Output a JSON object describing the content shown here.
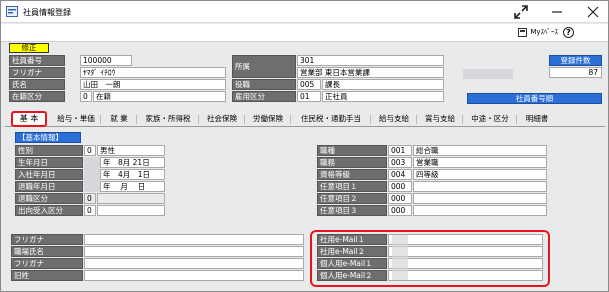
{
  "window": {
    "title": "社員情報登録"
  },
  "toolbar": {
    "myspace_label": "Myｽﾍﾟｰｽ",
    "help_label": "?"
  },
  "header": {
    "modify_badge": "修正",
    "left_fields": [
      {
        "label": "社員番号",
        "value": "100000"
      },
      {
        "label": "フリガナ",
        "value": "ﾔﾏﾀﾞ  ｲﾁﾛｳ"
      },
      {
        "label": "氏名",
        "value": "山田　一朗"
      },
      {
        "label": "在籍区分",
        "code": "0",
        "value": "在籍"
      }
    ],
    "mid_fields": [
      {
        "label": "所属",
        "code": "301",
        "value": "営業部 東日本営業課"
      },
      {
        "label": "役職",
        "code": "005",
        "value": "課長"
      },
      {
        "label": "雇用区分",
        "code": "01",
        "value": "正社員"
      }
    ],
    "register_count_label": "登録件数",
    "register_count_value": "87",
    "sort_order_label": "社員番号順"
  },
  "tabs": [
    {
      "label": "基 本",
      "active": true
    },
    {
      "label": "給与・単価"
    },
    {
      "label": "就 業"
    },
    {
      "label": "家族・所得税"
    },
    {
      "label": "社会保険"
    },
    {
      "label": "労働保険"
    },
    {
      "label": "住民税・通勤手当"
    },
    {
      "label": "給与支給"
    },
    {
      "label": "賞与支給"
    },
    {
      "label": "中途・区分"
    },
    {
      "label": "明細書"
    }
  ],
  "basic": {
    "section_title": "【基本情報】",
    "left_fields": [
      {
        "label": "性別",
        "code": "0",
        "value": "男性"
      },
      {
        "label": "生年月日",
        "value": "年　8月 21日"
      },
      {
        "label": "入社年月日",
        "value": "年　4月　1日"
      },
      {
        "label": "退職年月日",
        "value": "年　 月　 日"
      },
      {
        "label": "退職区分",
        "code": "0",
        "value": ""
      },
      {
        "label": "出向受入区分",
        "code": "0",
        "value": ""
      }
    ],
    "right_fields": [
      {
        "label": "職種",
        "code": "001",
        "value": "総合職"
      },
      {
        "label": "職務",
        "code": "003",
        "value": "営業職"
      },
      {
        "label": "資格等級",
        "code": "004",
        "value": "四等級"
      },
      {
        "label": "任意項目１",
        "code": "000",
        "value": ""
      },
      {
        "label": "任意項目２",
        "code": "000",
        "value": ""
      },
      {
        "label": "任意項目３",
        "code": "000",
        "value": ""
      }
    ],
    "lower_left": [
      {
        "label": "フリガナ",
        "value": ""
      },
      {
        "label": "職場氏名",
        "value": ""
      },
      {
        "label": "フリガナ",
        "value": ""
      },
      {
        "label": "旧姓",
        "value": ""
      }
    ],
    "mail": [
      {
        "label": "社用e-Mail１",
        "value": ""
      },
      {
        "label": "社用e-Mail２",
        "value": ""
      },
      {
        "label": "個人用e-Mail１",
        "value": ""
      },
      {
        "label": "個人用e-Mail２",
        "value": ""
      }
    ]
  }
}
